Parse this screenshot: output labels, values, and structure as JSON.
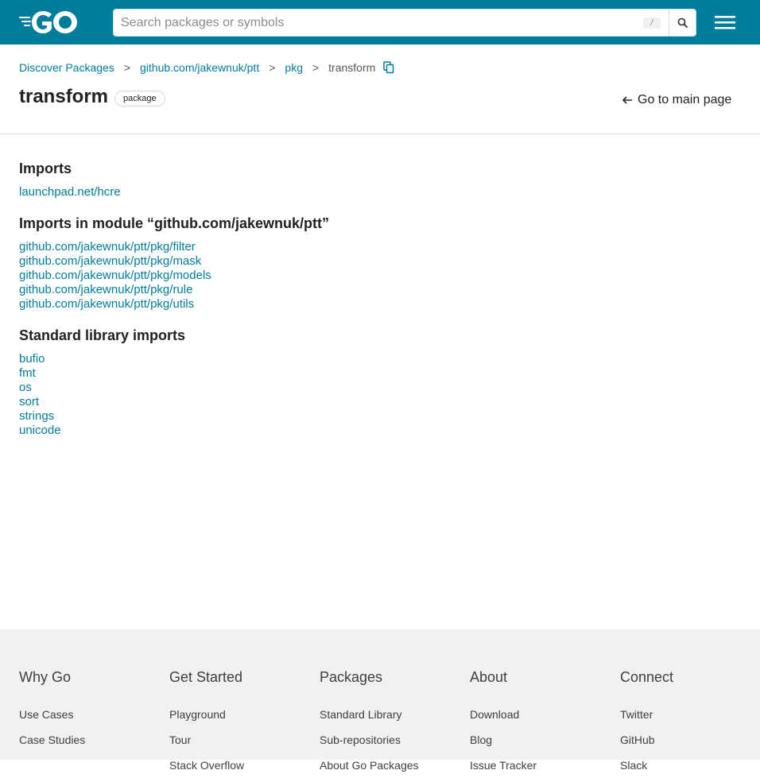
{
  "header": {
    "search_placeholder": "Search packages or symbols",
    "search_shortcut": "/",
    "brand_color": "#007d9c"
  },
  "breadcrumb": {
    "items": [
      "Discover Packages",
      "github.com/jakewnuk/ptt",
      "pkg"
    ],
    "current": "transform",
    "separator": ">"
  },
  "title": {
    "name": "transform",
    "badge": "package",
    "go_main": "Go to main page"
  },
  "sections": [
    {
      "title": "Imports",
      "links": [
        "launchpad.net/hcre"
      ]
    },
    {
      "title": "Imports in module “github.com/jakewnuk/ptt”",
      "links": [
        "github.com/jakewnuk/ptt/pkg/filter",
        "github.com/jakewnuk/ptt/pkg/mask",
        "github.com/jakewnuk/ptt/pkg/models",
        "github.com/jakewnuk/ptt/pkg/rule",
        "github.com/jakewnuk/ptt/pkg/utils"
      ]
    },
    {
      "title": "Standard library imports",
      "links": [
        "bufio",
        "fmt",
        "os",
        "sort",
        "strings",
        "unicode"
      ]
    }
  ],
  "footer": {
    "columns": [
      {
        "title": "Why Go",
        "links": [
          "Use Cases",
          "Case Studies"
        ]
      },
      {
        "title": "Get Started",
        "links": [
          "Playground",
          "Tour",
          "Stack Overflow"
        ]
      },
      {
        "title": "Packages",
        "links": [
          "Standard Library",
          "Sub-repositories",
          "About Go Packages"
        ]
      },
      {
        "title": "About",
        "links": [
          "Download",
          "Blog",
          "Issue Tracker"
        ]
      },
      {
        "title": "Connect",
        "links": [
          "Twitter",
          "GitHub",
          "Slack"
        ]
      }
    ]
  }
}
